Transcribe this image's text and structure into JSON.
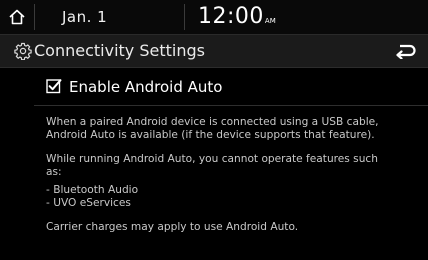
{
  "status": {
    "date": "Jan.  1",
    "time": "12:00",
    "ampm": "AM"
  },
  "header": {
    "title": "Connectivity Settings"
  },
  "icons": {
    "home": "home-icon",
    "settings": "gear-icon",
    "back": "back-arrow-icon",
    "checkbox": "checkbox-checked-icon"
  },
  "option": {
    "label": "Enable Android Auto",
    "checked": true
  },
  "description": {
    "line1": "When a paired Android device is connected using a USB cable,",
    "line2": "Android Auto is available (if the device supports that feature).",
    "line3": "While running Android Auto, you cannot operate features such",
    "line4": "as:",
    "bullet1": "- Bluetooth Audio",
    "bullet2": "- UVO eServices",
    "note": "Carrier charges may apply to use Android Auto."
  },
  "colors": {
    "background": "#000000",
    "header": "#1b1b1b",
    "text": "#ffffff",
    "muted_text": "#c9c9c9"
  }
}
